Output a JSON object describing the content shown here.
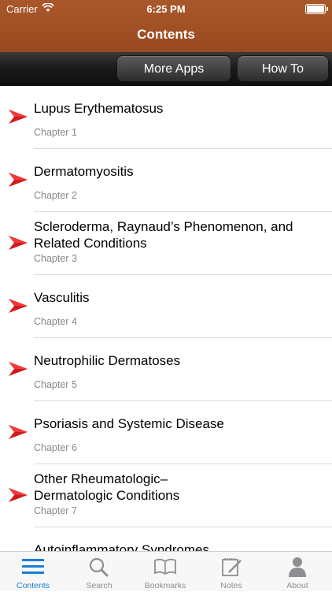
{
  "status": {
    "carrier": "Carrier",
    "time": "6:25 PM"
  },
  "nav": {
    "title": "Contents"
  },
  "buttons": {
    "more_apps": "More Apps",
    "how_to": "How To"
  },
  "chapters": [
    {
      "title": "Lupus Erythematosus",
      "sub": "Chapter 1"
    },
    {
      "title": "Dermatomyositis",
      "sub": "Chapter 2"
    },
    {
      "title": "Scleroderma, Raynaud’s Phenomenon, and Related Conditions",
      "sub": "Chapter 3"
    },
    {
      "title": "Vasculitis",
      "sub": "Chapter 4"
    },
    {
      "title": "Neutrophilic Dermatoses",
      "sub": "Chapter 5"
    },
    {
      "title": "Psoriasis and Systemic Disease",
      "sub": "Chapter 6"
    },
    {
      "title": "Other Rheumatologic–Dermatologic Conditions",
      "sub": "Chapter 7"
    },
    {
      "title": "Autoinflammatory Syndromes",
      "sub": ""
    }
  ],
  "tabs": [
    {
      "label": "Contents",
      "icon": "list-icon",
      "active": true
    },
    {
      "label": "Search",
      "icon": "search-icon"
    },
    {
      "label": "Bookmarks",
      "icon": "book-icon"
    },
    {
      "label": "Notes",
      "icon": "notes-icon"
    },
    {
      "label": "About",
      "icon": "person-icon"
    }
  ],
  "colors": {
    "nav": "#9a4a20",
    "arrow": "#d11a1a",
    "accent": "#1a7fd6"
  }
}
